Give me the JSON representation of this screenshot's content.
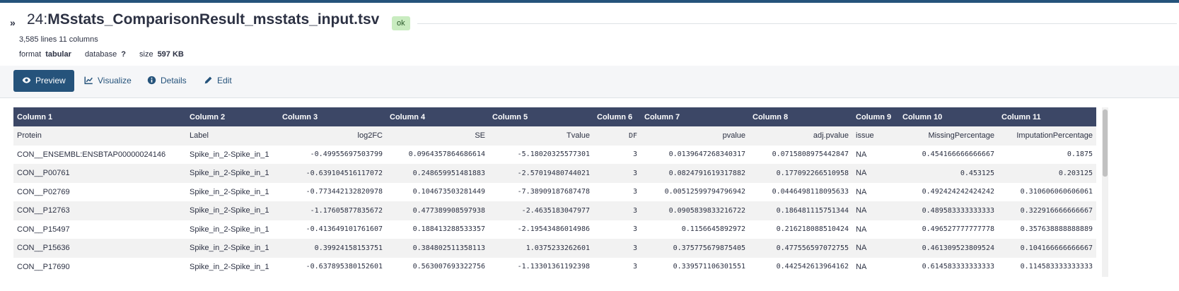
{
  "dataset": {
    "hid": "24:",
    "name": "MSstats_ComparisonResult_msstats_input.tsv",
    "state": "ok",
    "lines_info": "3,585 lines 11 columns",
    "format_label": "format",
    "format_value": "tabular",
    "database_label": "database",
    "database_value": "?",
    "size_label": "size",
    "size_value": "597 KB"
  },
  "tabs": [
    {
      "label": "Preview",
      "icon": "eye-icon",
      "active": true
    },
    {
      "label": "Visualize",
      "icon": "chart-line-icon",
      "active": false
    },
    {
      "label": "Details",
      "icon": "info-circle-icon",
      "active": false
    },
    {
      "label": "Edit",
      "icon": "pencil-icon",
      "active": false
    }
  ],
  "table": {
    "headers": [
      "Column 1",
      "Column 2",
      "Column 3",
      "Column 4",
      "Column 5",
      "Column 6",
      "Column 7",
      "Column 8",
      "Column 9",
      "Column 10",
      "Column 11"
    ],
    "rows": [
      [
        "Protein",
        "Label",
        "log2FC",
        "SE",
        "Tvalue",
        "DF",
        "pvalue",
        "adj.pvalue",
        "issue",
        "MissingPercentage",
        "ImputationPercentage"
      ],
      [
        "CON__ENSEMBL:ENSBTAP00000024146",
        "Spike_in_2-Spike_in_1",
        "-0.49955697503799",
        "0.0964357864686614",
        "-5.18020325577301",
        "3",
        "0.0139647268340317",
        "0.0715808975442847",
        "NA",
        "0.454166666666667",
        "0.1875"
      ],
      [
        "CON__P00761",
        "Spike_in_2-Spike_in_1",
        "-0.639104516117072",
        "0.248659951481883",
        "-2.57019480744021",
        "3",
        "0.0824791619317882",
        "0.177092266510958",
        "NA",
        "0.453125",
        "0.203125"
      ],
      [
        "CON__P02769",
        "Spike_in_2-Spike_in_1",
        "-0.773442132820978",
        "0.104673503281449",
        "-7.38909187687478",
        "3",
        "0.00512599794796942",
        "0.0446498118095633",
        "NA",
        "0.492424242424242",
        "0.310606060606061"
      ],
      [
        "CON__P12763",
        "Spike_in_2-Spike_in_1",
        "-1.17605877835672",
        "0.477389908597938",
        "-2.4635183047977",
        "3",
        "0.0905839833216722",
        "0.186481115751344",
        "NA",
        "0.489583333333333",
        "0.322916666666667"
      ],
      [
        "CON__P15497",
        "Spike_in_2-Spike_in_1",
        "-0.413649101761607",
        "0.188413288533357",
        "-2.19543486014986",
        "3",
        "0.1156645892972",
        "0.216218088510424",
        "NA",
        "0.496527777777778",
        "0.357638888888889"
      ],
      [
        "CON__P15636",
        "Spike_in_2-Spike_in_1",
        "0.39924158153751",
        "0.384802511358113",
        "1.0375233262601",
        "3",
        "0.375775679875405",
        "0.477556597072755",
        "NA",
        "0.461309523809524",
        "0.104166666666667"
      ],
      [
        "CON__P17690",
        "Spike_in_2-Spike_in_1",
        "-0.637895380152601",
        "0.563007693322756",
        "-1.13301361192398",
        "3",
        "0.339571106301551",
        "0.442542613964162",
        "NA",
        "0.614583333333333",
        "0.114583333333333"
      ]
    ]
  }
}
